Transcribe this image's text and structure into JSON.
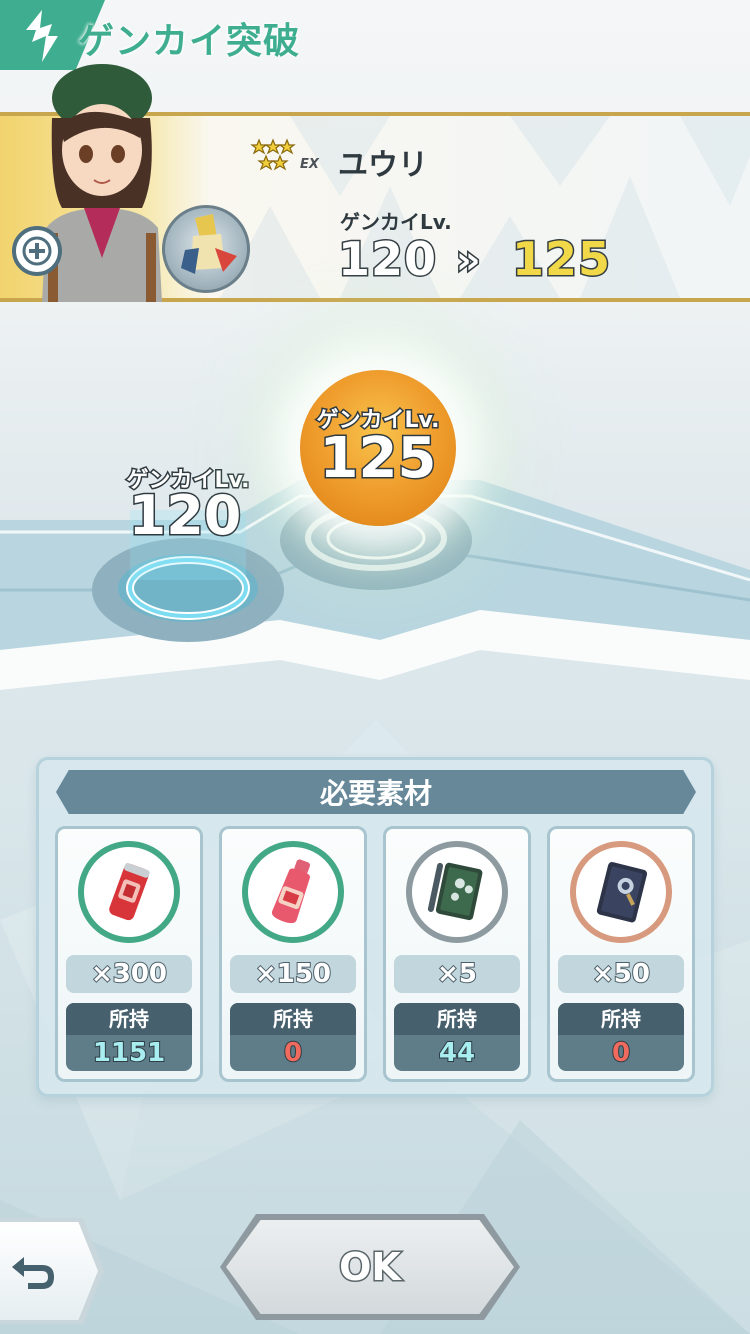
{
  "header": {
    "title": "ゲンカイ突破",
    "accent": "#3fae90"
  },
  "character": {
    "name": "ユウリ",
    "rank_badge": "EX",
    "stars": 5,
    "level_label": "ゲンカイLv.",
    "level_from": "120",
    "level_arrow": "»",
    "level_to": "125"
  },
  "track": {
    "current": {
      "label": "ゲンカイLv.",
      "value": "120"
    },
    "next": {
      "label": "ゲンカイLv.",
      "value": "125"
    }
  },
  "materials": {
    "header": "必要素材",
    "owned_label": "所持",
    "items": [
      {
        "icon": "red-can-icon",
        "ring": "green",
        "required": "×300",
        "owned": "1151",
        "enough": true
      },
      {
        "icon": "red-bottle-icon",
        "ring": "green",
        "required": "×150",
        "owned": "0",
        "enough": false
      },
      {
        "icon": "green-notebook-icon",
        "ring": "gray",
        "required": "×5",
        "owned": "44",
        "enough": true
      },
      {
        "icon": "dark-book-icon",
        "ring": "orange",
        "required": "×50",
        "owned": "0",
        "enough": false
      }
    ]
  },
  "buttons": {
    "ok": "OK",
    "back_icon": "return-arrow-icon"
  },
  "colors": {
    "enough": "#a8eef0",
    "lacking": "#f06a5e",
    "orb": "#f0a030",
    "panel_header": "#668899"
  }
}
